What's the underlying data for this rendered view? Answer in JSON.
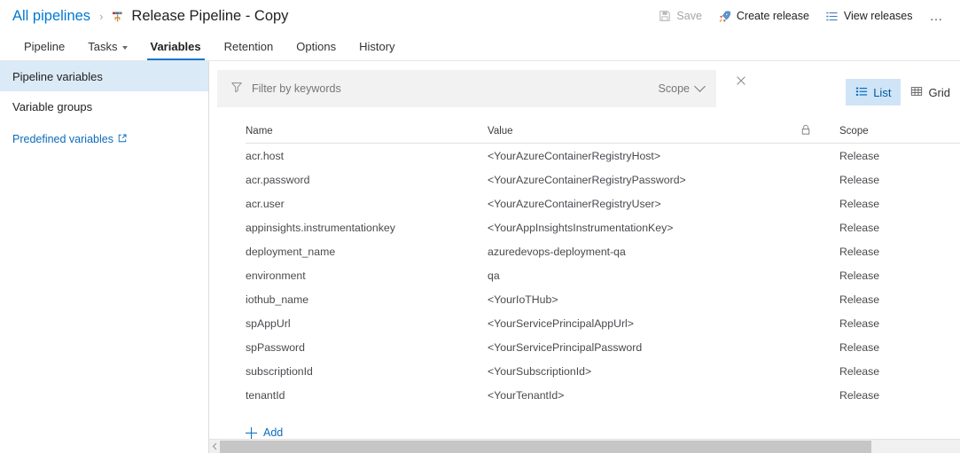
{
  "header": {
    "breadcrumb_root": "All pipelines",
    "breadcrumb_separator": "›",
    "title": "Release Pipeline - Copy",
    "pipeline_icon": "release-pipeline-icon",
    "actions": [
      {
        "label": "Save",
        "icon": "save-floppy-icon",
        "disabled": true
      },
      {
        "label": "Create release",
        "icon": "rocket-icon",
        "disabled": false
      },
      {
        "label": "View releases",
        "icon": "list-lines-icon",
        "disabled": false
      }
    ],
    "more_label": "…"
  },
  "tabs": [
    {
      "label": "Pipeline",
      "selected": false,
      "has_caret": false
    },
    {
      "label": "Tasks",
      "selected": false,
      "has_caret": true
    },
    {
      "label": "Variables",
      "selected": true,
      "has_caret": false
    },
    {
      "label": "Retention",
      "selected": false,
      "has_caret": false
    },
    {
      "label": "Options",
      "selected": false,
      "has_caret": false
    },
    {
      "label": "History",
      "selected": false,
      "has_caret": false
    }
  ],
  "sidebar": {
    "items": [
      {
        "label": "Pipeline variables",
        "selected": true
      },
      {
        "label": "Variable groups",
        "selected": false
      }
    ],
    "external_link": {
      "label": "Predefined variables",
      "icon": "external-link-icon"
    }
  },
  "filter": {
    "icon": "funnel-filter-icon",
    "placeholder": "Filter by keywords",
    "scope_label": "Scope",
    "clear_icon": "close-x-icon"
  },
  "view_toggle": {
    "list": {
      "label": "List",
      "icon": "list-view-icon",
      "selected": true
    },
    "grid": {
      "label": "Grid",
      "icon": "grid-view-icon",
      "selected": false
    }
  },
  "table": {
    "columns": {
      "name": "Name",
      "value": "Value",
      "lock": "lock-icon",
      "scope": "Scope"
    },
    "rows": [
      {
        "name": "acr.host",
        "value": "<YourAzureContainerRegistryHost>",
        "scope": "Release"
      },
      {
        "name": "acr.password",
        "value": "<YourAzureContainerRegistryPassword>",
        "scope": "Release"
      },
      {
        "name": "acr.user",
        "value": "<YourAzureContainerRegistryUser>",
        "scope": "Release"
      },
      {
        "name": "appinsights.instrumentationkey",
        "value": "<YourAppInsightsInstrumentationKey>",
        "scope": "Release"
      },
      {
        "name": "deployment_name",
        "value": "azuredevops-deployment-qa",
        "scope": "Release"
      },
      {
        "name": "environment",
        "value": "qa",
        "scope": "Release"
      },
      {
        "name": "iothub_name",
        "value": "<YourIoTHub>",
        "scope": "Release"
      },
      {
        "name": "spAppUrl",
        "value": "<YourServicePrincipalAppUrl>",
        "scope": "Release"
      },
      {
        "name": "spPassword",
        "value": "<YourServicePrincipalPassword",
        "scope": "Release"
      },
      {
        "name": "subscriptionId",
        "value": "<YourSubscriptionId>",
        "scope": "Release"
      },
      {
        "name": "tenantId",
        "value": "<YourTenantId>",
        "scope": "Release"
      }
    ]
  },
  "add_button": {
    "label": "Add",
    "icon": "plus-icon"
  },
  "colors": {
    "accent": "#0078d4",
    "link": "#0b6cbb",
    "selected_bg": "#dbeaf7",
    "toggle_selected_bg": "#cfe4f7",
    "filter_bg": "#f2f2f2",
    "text": "#4a4a50"
  }
}
